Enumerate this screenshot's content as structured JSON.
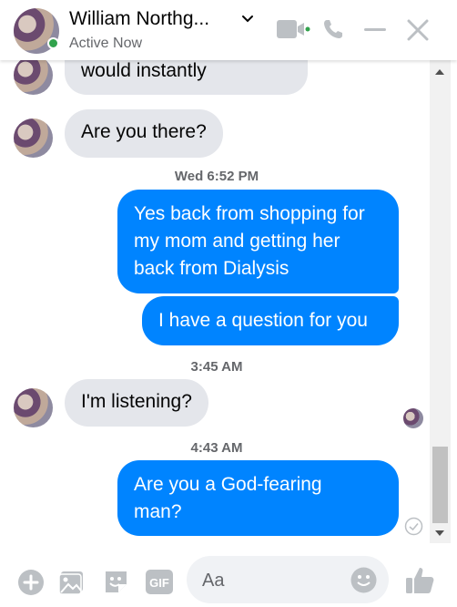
{
  "header": {
    "name": "William Northg...",
    "status": "Active Now",
    "icons": [
      "video-call-icon",
      "phone-icon",
      "minimize-icon",
      "close-icon"
    ]
  },
  "messages": [
    {
      "side": "in",
      "text": "would instantly"
    },
    {
      "side": "in",
      "text": "Are you there?"
    },
    {
      "type": "time",
      "text": "Wed 6:52 PM"
    },
    {
      "side": "out",
      "lines": [
        "Yes back from shopping for",
        "my mom and getting her",
        "back from Dialysis"
      ]
    },
    {
      "side": "out",
      "text": "I have a question for you"
    },
    {
      "type": "time",
      "text": "3:45 AM"
    },
    {
      "side": "in",
      "text": "I'm listening?"
    },
    {
      "type": "time",
      "text": "4:43 AM"
    },
    {
      "side": "out",
      "lines": [
        "Are you a God-fearing",
        "man?"
      ]
    }
  ],
  "composer": {
    "placeholder": "Aa",
    "icons": [
      "add-icon",
      "photo-icon",
      "sticker-icon",
      "gif-icon",
      "emoji-icon",
      "like-icon"
    ]
  },
  "colors": {
    "outgoing": "#0084ff",
    "incoming": "#e4e6eb",
    "online": "#31a24c"
  }
}
